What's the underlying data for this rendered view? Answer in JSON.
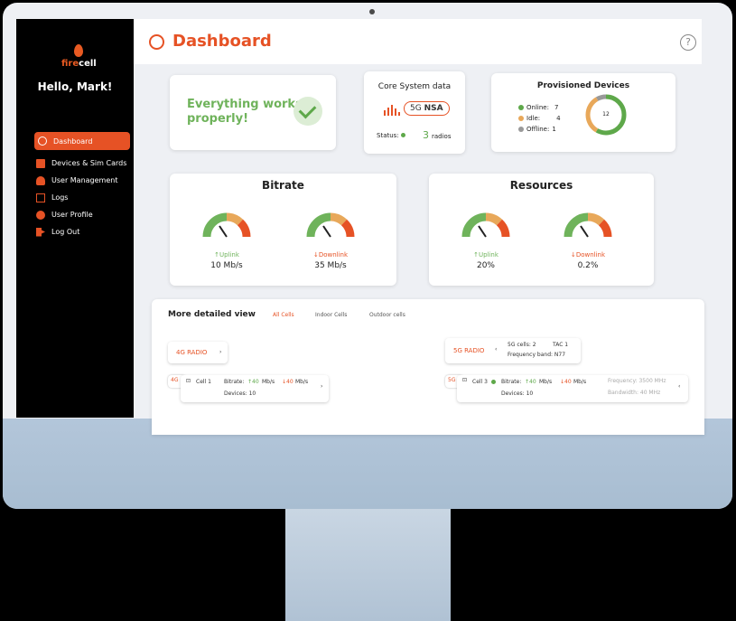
{
  "brand": {
    "fire": "fire",
    "cell": "cell"
  },
  "greeting": "Hello, Mark!",
  "sidebar": {
    "items": [
      {
        "label": "Dashboard",
        "icon": "dashboard-icon",
        "active": true
      },
      {
        "label": "Devices & Sim Cards",
        "icon": "sim-card-icon"
      },
      {
        "label": "User Management",
        "icon": "user-management-icon"
      },
      {
        "label": "Logs",
        "icon": "logs-icon"
      },
      {
        "label": "User Profile",
        "icon": "user-profile-icon"
      },
      {
        "label": "Log Out",
        "icon": "logout-icon"
      }
    ]
  },
  "header": {
    "title": "Dashboard",
    "help": "?"
  },
  "status_card": {
    "message_line1": "Everything works",
    "message_line2": "properly!"
  },
  "core_card": {
    "title": "Core System data",
    "network": "5G",
    "network_mode": "NSA",
    "status_label": "Status:",
    "radios_count": "3",
    "radios_label": "radios"
  },
  "devices_card": {
    "title": "Provisioned Devices",
    "online_label": "Online:",
    "online": "7",
    "idle_label": "Idle:",
    "idle": "4",
    "offline_label": "Offline:",
    "offline": "1",
    "total": "12"
  },
  "bitrate_card": {
    "title": "Bitrate",
    "uplink_label": "↑Uplink",
    "uplink": "10 Mb/s",
    "downlink_label": "↓Downlink",
    "downlink": "35 Mb/s"
  },
  "resources_card": {
    "title": "Resources",
    "uplink_label": "↑Uplink",
    "uplink": "20%",
    "downlink_label": "↓Downlink",
    "downlink": "0.2%"
  },
  "detail": {
    "title": "More detailed view",
    "tabs": [
      "All Cells",
      "Indoor Cells",
      "Outdoor cells"
    ],
    "radio4g": {
      "label": "4G RADIO",
      "tag": "4G",
      "cell": "Cell 1",
      "bitrate_label": "Bitrate:",
      "up": "↑40",
      "unit": "Mb/s",
      "down": "↓40",
      "unit2": "Mb/s",
      "devices": "Devices: 10"
    },
    "radio5g": {
      "label": "5G RADIO",
      "cells": "5G cells: 2",
      "tac": "TAC 1",
      "band": "Frequency band: N77",
      "tag": "5G",
      "cell": "Cell 3",
      "bitrate_label": "Bitrate:",
      "up": "↑40",
      "unit": "Mb/s",
      "down": "↓40",
      "unit2": "Mb/s",
      "devices": "Devices: 10",
      "freq": "Frequency: 3500 MHz",
      "bw": "Bandwidth: 40 MHz"
    }
  },
  "colors": {
    "accent": "#e65225",
    "ok": "#5ea84a",
    "idle": "#e8a85a",
    "offline": "#999999"
  }
}
